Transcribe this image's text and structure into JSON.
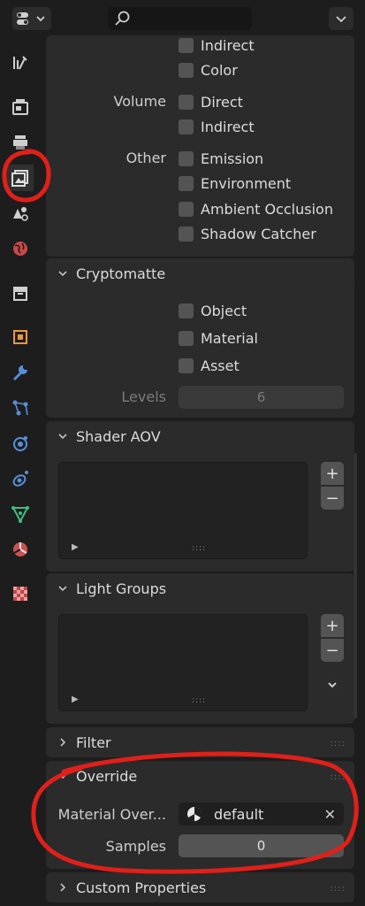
{
  "passes": {
    "light_rows": [
      "Indirect",
      "Color"
    ],
    "volume": {
      "label": "Volume",
      "items": [
        "Direct",
        "Indirect"
      ]
    },
    "other": {
      "label": "Other",
      "items": [
        "Emission",
        "Environment",
        "Ambient Occlusion",
        "Shadow Catcher"
      ]
    }
  },
  "cryptomatte": {
    "title": "Cryptomatte",
    "items": [
      "Object",
      "Material",
      "Asset"
    ],
    "levels_label": "Levels",
    "levels_value": "6"
  },
  "shader_aov": {
    "title": "Shader AOV"
  },
  "light_groups": {
    "title": "Light Groups"
  },
  "list_controls": {
    "add": "+",
    "remove": "−"
  },
  "filter": {
    "title": "Filter"
  },
  "override": {
    "title": "Override",
    "material_label": "Material Over...",
    "material_value": "default",
    "samples_label": "Samples",
    "samples_value": "0"
  },
  "custom_properties": {
    "title": "Custom Properties"
  },
  "colors": {
    "annotation": "#e0201a",
    "accent": "#4772b3"
  }
}
